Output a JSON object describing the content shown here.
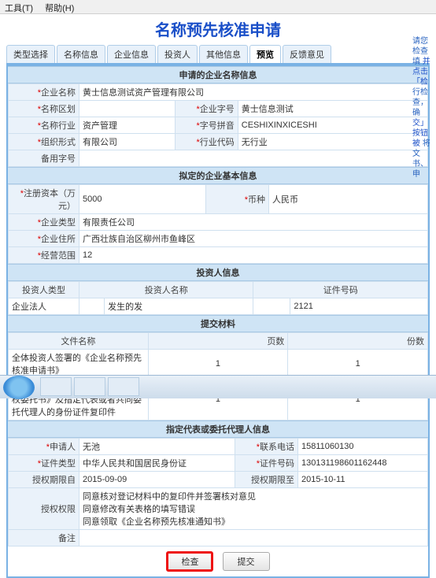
{
  "menu": {
    "tools": "工具(T)",
    "help": "帮助(H)"
  },
  "title": "名称预先核准申请",
  "sidenote": [
    "请您检查填",
    "并点击「检",
    "行检查，确",
    "交」按钮被",
    "将文书、申"
  ],
  "tabs": [
    "类型选择",
    "名称信息",
    "企业信息",
    "投资人",
    "其他信息",
    "预览",
    "反馈意见"
  ],
  "sec1": {
    "hdr": "申请的企业名称信息",
    "name_l": "企业名称",
    "name_v": "黄士信息测试资产管理有限公司",
    "area_l": "名称区划",
    "area_v": "",
    "zh_l": "企业字号",
    "zh_v": "黄士信息测试",
    "ind_l": "名称行业",
    "ind_v": "资产管理",
    "py_l": "字号拼音",
    "py_v": "CESHIXINXICESHI",
    "org_l": "组织形式",
    "org_v": "有限公司",
    "izc_l": "行业代码",
    "izc_v": "无行业",
    "bak_l": "备用字号",
    "bak_v": ""
  },
  "sec2": {
    "hdr": "拟定的企业基本信息",
    "cap_l": "注册资本（万元）",
    "cap_v": "5000",
    "cur_l": "币种",
    "cur_v": "人民币",
    "type_l": "企业类型",
    "type_v": "有限责任公司",
    "addr_l": "企业住所",
    "addr_v": "广西壮族自治区柳州市鱼峰区",
    "scope_l": "经营范围",
    "scope_v": "12"
  },
  "sec3": {
    "hdr": "投资人信息",
    "c1": "投资人类型",
    "c2": "投资人名称",
    "c3": "证件号码",
    "t1": "企业法人",
    "t2": "",
    "t3": "发生的发",
    "t4": "",
    "t5": "2121"
  },
  "sec4": {
    "hdr": "提交材料",
    "c1": "文件名称",
    "c2": "页数",
    "c3": "份数",
    "r1": "全体投资人签署的《企业名称预先核准申请书》",
    "r1p": "1",
    "r1c": "1",
    "r2": "《指定代表或者共同委托代理人授权委托书》及指定代表或者共同委托代理人的身份证件复印件",
    "r2p": "1",
    "r2c": "1"
  },
  "sec5": {
    "hdr": "指定代表或委托代理人信息",
    "app_l": "申请人",
    "app_v": "无池",
    "tel_l": "联系电话",
    "tel_v": "15811060130",
    "idt_l": "证件类型",
    "idt_v": "中华人民共和国居民身份证",
    "idn_l": "证件号码",
    "idn_v": "130131198601162448",
    "d1_l": "授权期限自",
    "d1_v": "2015-09-09",
    "d2_l": "授权期限至",
    "d2_v": "2015-10-11",
    "pow_l": "授权权限",
    "pow_v1": "同意核对登记材料中的复印件并签署核对意见",
    "pow_v2": "同意修改有关表格的填写错误",
    "pow_v3": "同意领取《企业名称预先核准通知书》",
    "note_l": "备注",
    "note_v": ""
  },
  "btns": {
    "check": "检查",
    "submit": "提交"
  }
}
